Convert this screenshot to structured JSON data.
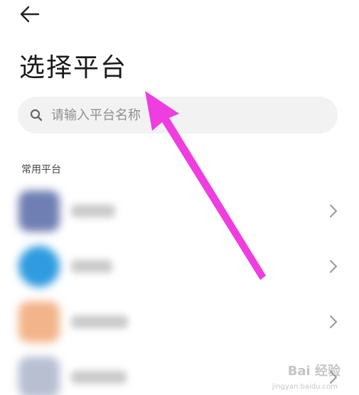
{
  "header": {
    "back_icon": "arrow-left-icon",
    "title": "选择平台"
  },
  "search": {
    "icon": "search-icon",
    "placeholder": "请输入平台名称"
  },
  "section": {
    "label": "常用平台"
  },
  "platforms": [
    {
      "avatar_color": "#6f7fb3",
      "chevron_icon": "chevron-right-icon"
    },
    {
      "avatar_color": "#2f9be0",
      "chevron_icon": "chevron-right-icon"
    },
    {
      "avatar_color": "#f2b48a",
      "chevron_icon": "chevron-right-icon"
    },
    {
      "avatar_color": "#b7bfd1",
      "chevron_icon": "chevron-right-icon"
    }
  ],
  "annotation": {
    "arrow_color": "#ee3ee0"
  },
  "watermark": {
    "text": "Bai  经验",
    "sub": "jingyan.baidu.com"
  }
}
